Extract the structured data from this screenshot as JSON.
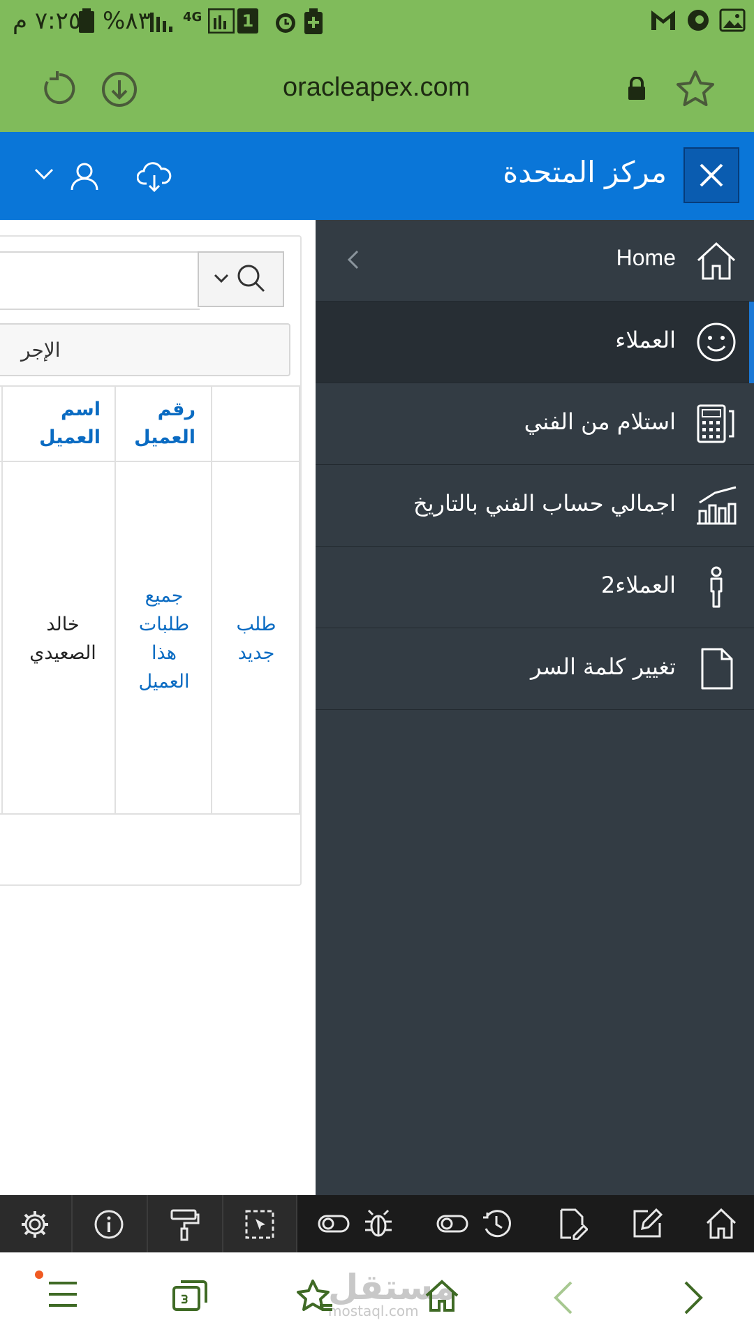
{
  "status_bar": {
    "time": "٧:٢٥ م",
    "battery": "%٨٣",
    "network": "4G",
    "sim": "1"
  },
  "browser": {
    "url": "oracleapex.com"
  },
  "header": {
    "title": "مركز المتحدة"
  },
  "nav": {
    "items": [
      {
        "label": "Home",
        "icon": "home-icon"
      },
      {
        "label": "العملاء",
        "icon": "smiley-icon"
      },
      {
        "label": "استلام من الفني",
        "icon": "calculator-icon"
      },
      {
        "label": "اجمالي حساب الفني بالتاريخ",
        "icon": "bar-chart-icon"
      },
      {
        "label": "العملاء2",
        "icon": "person-icon"
      },
      {
        "label": "تغيير كلمة السر",
        "icon": "document-icon"
      }
    ]
  },
  "content": {
    "actions_label": "الإجر",
    "columns": [
      "رقم العميل",
      "اسم العميل"
    ],
    "col1_line1": "رقم",
    "col1_line2": "العميل",
    "col2_line1": "اسم",
    "col2_line2": "العميل",
    "row": {
      "new_request_1": "طلب",
      "new_request_2": "جديد",
      "all_requests_1": "جميع",
      "all_requests_2": "طلبات",
      "all_requests_3": "هذا",
      "all_requests_4": "العميل",
      "customer_name_1": "خالد",
      "customer_name_2": "الصعيدي"
    }
  },
  "watermark": {
    "text": "مستقل",
    "sub": "mostaql.com"
  },
  "colors": {
    "browser_green": "#80BB5B",
    "header_blue": "#0A76D8",
    "nav_dark": "#333C44",
    "link_blue": "#0A6BC2"
  }
}
